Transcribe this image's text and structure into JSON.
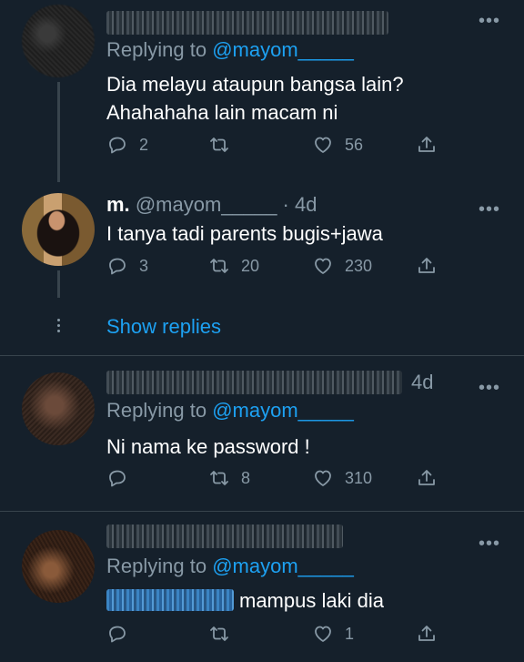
{
  "tweets": [
    {
      "replying_prefix": "Replying to ",
      "replying_handle": "@mayom_____",
      "text_lines": [
        "Dia melayu ataupun bangsa lain?",
        "Ahahahaha lain macam ni"
      ],
      "replies": "2",
      "retweets": "",
      "likes": "56"
    },
    {
      "display_name": "m.",
      "handle_time": "@mayom_____ · 4d",
      "text_lines": [
        "I tanya tadi parents bugis+jawa"
      ],
      "replies": "3",
      "retweets": "20",
      "likes": "230"
    },
    {
      "time": "4d",
      "replying_prefix": "Replying to ",
      "replying_handle": "@mayom_____",
      "text_lines": [
        "Ni nama ke password !"
      ],
      "replies": "",
      "retweets": "8",
      "likes": "310"
    },
    {
      "replying_prefix": "Replying to ",
      "replying_handle": "@mayom_____",
      "text_lines": [
        "mampus laki dia"
      ],
      "replies": "",
      "retweets": "",
      "likes": "1"
    }
  ],
  "show_replies": "Show replies",
  "more_glyph": "•••",
  "icons": [
    "reply-icon",
    "retweet-icon",
    "like-icon",
    "share-icon",
    "more-icon"
  ],
  "colors": {
    "background": "#15202b",
    "accent": "#1da1f2",
    "muted": "#8899a6",
    "divider": "#38444d"
  }
}
